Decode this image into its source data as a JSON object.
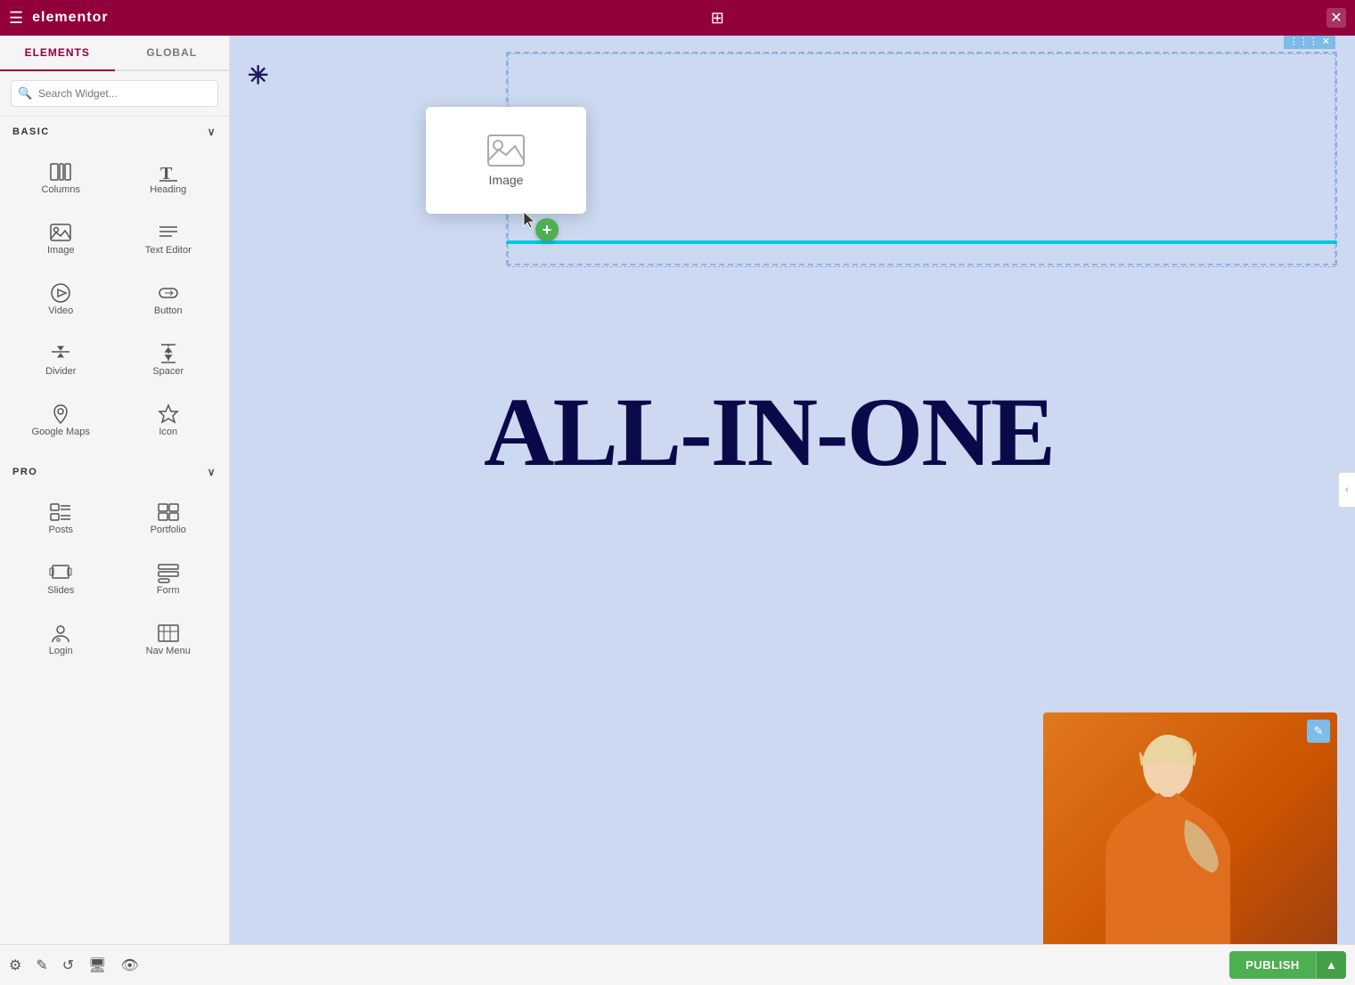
{
  "topbar": {
    "logo": "elementor",
    "close_label": "✕"
  },
  "sidebar": {
    "tab_elements": "ELEMENTS",
    "tab_global": "GLOBAL",
    "search_placeholder": "Search Widget...",
    "section_basic": "BASIC",
    "section_pro": "PRO",
    "basic_widgets": [
      {
        "id": "columns",
        "label": "Columns",
        "icon": "columns"
      },
      {
        "id": "heading",
        "label": "Heading",
        "icon": "heading"
      },
      {
        "id": "image",
        "label": "Image",
        "icon": "image"
      },
      {
        "id": "text-editor",
        "label": "Text Editor",
        "icon": "text-editor"
      },
      {
        "id": "video",
        "label": "Video",
        "icon": "video"
      },
      {
        "id": "button",
        "label": "Button",
        "icon": "button"
      },
      {
        "id": "divider",
        "label": "Divider",
        "icon": "divider"
      },
      {
        "id": "spacer",
        "label": "Spacer",
        "icon": "spacer"
      },
      {
        "id": "google-maps",
        "label": "Google Maps",
        "icon": "google-maps"
      },
      {
        "id": "icon",
        "label": "Icon",
        "icon": "icon"
      }
    ],
    "pro_widgets": [
      {
        "id": "posts",
        "label": "Posts",
        "icon": "posts"
      },
      {
        "id": "portfolio",
        "label": "Portfolio",
        "icon": "portfolio"
      },
      {
        "id": "slides",
        "label": "Slides",
        "icon": "slides"
      },
      {
        "id": "form",
        "label": "Form",
        "icon": "form"
      },
      {
        "id": "login",
        "label": "Login",
        "icon": "login"
      },
      {
        "id": "nav-menu",
        "label": "Nav Menu",
        "icon": "nav-menu"
      }
    ]
  },
  "canvas": {
    "all_in_one_text": "ALL-IN-ONE",
    "section_controls": [
      "⋮⋮⋮",
      "✕"
    ],
    "image_drag_label": "Image",
    "plus_icon": "+"
  },
  "bottombar": {
    "publish_label": "PUBLISH",
    "arrow_label": "▲"
  }
}
